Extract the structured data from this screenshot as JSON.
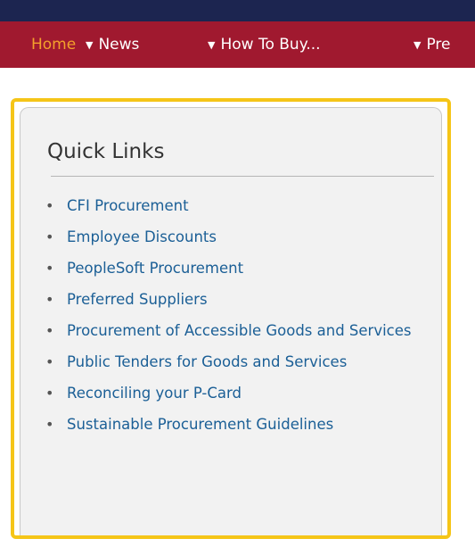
{
  "nav": {
    "items": [
      {
        "label": "Home",
        "active": true,
        "has_caret": false
      },
      {
        "label": "News",
        "active": false,
        "has_caret": true
      },
      {
        "label": "How To Buy...",
        "active": false,
        "has_caret": true
      },
      {
        "label": "Pre",
        "active": false,
        "has_caret": true
      }
    ],
    "caret_glyph": "▼"
  },
  "colors": {
    "top_bar": "#1c2550",
    "nav_bar": "#a0192f",
    "nav_active": "#f4a02c",
    "panel_border": "#f5c518",
    "link": "#1b5f96"
  },
  "quick_links": {
    "title": "Quick Links",
    "bullet": "•",
    "items": [
      {
        "label": "CFI Procurement"
      },
      {
        "label": "Employee Discounts"
      },
      {
        "label": "PeopleSoft Procurement"
      },
      {
        "label": "Preferred Suppliers"
      },
      {
        "label": "Procurement of Accessible Goods and Services"
      },
      {
        "label": "Public Tenders for Goods and Services"
      },
      {
        "label": "Reconciling your P-Card"
      },
      {
        "label": "Sustainable Procurement Guidelines"
      }
    ]
  }
}
